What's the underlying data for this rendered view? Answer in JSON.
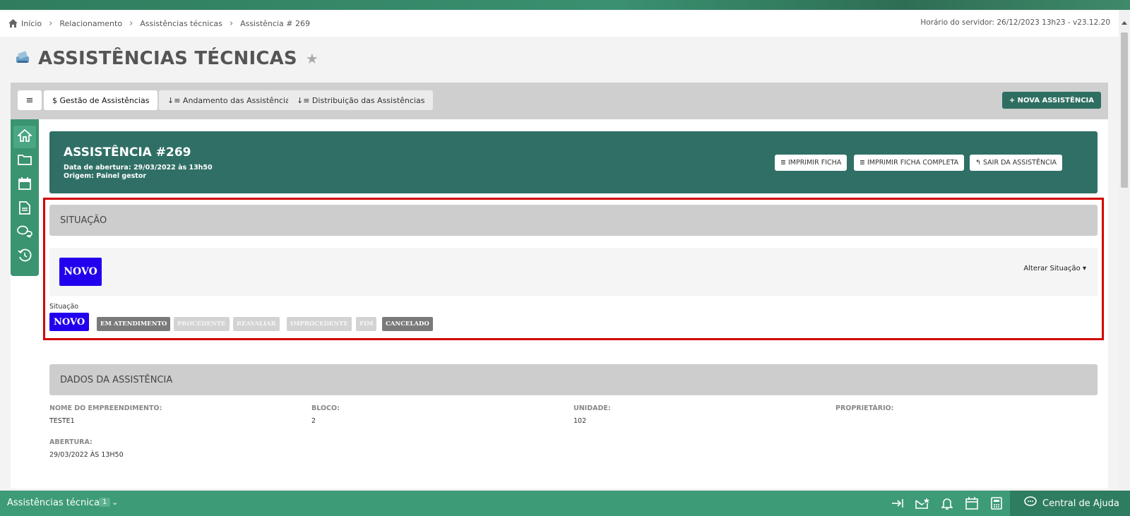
{
  "breadcrumb": {
    "items": [
      "Início",
      "Relacionamento",
      "Assistências técnicas",
      "Assistência # 269"
    ],
    "server_time": "Horário do servidor: 26/12/2023 13h23 - v23.12.20"
  },
  "page": {
    "title": "ASSISTÊNCIAS TÉCNICAS"
  },
  "tabs": [
    {
      "label": "$ Gestão de Assistências"
    },
    {
      "label": "↓≡ Andamento das Assistências"
    },
    {
      "label": "↓≡ Distribuição das Assistências"
    }
  ],
  "new_button": "+ NOVA ASSISTÊNCIA",
  "header": {
    "title": "ASSISTÊNCIA #269",
    "opened": "Data de abertura: 29/03/2022 às 13h50",
    "origin": "Origem: Painel gestor",
    "buttons": [
      "≣ IMPRIMIR FICHA",
      "≣ IMPRIMIR FICHA COMPLETA",
      "↰ SAIR DA ASSISTÊNCIA"
    ]
  },
  "situacao": {
    "heading": "SITUAÇÃO",
    "current": "NOVO",
    "change_label": "Alterar Situação ▾",
    "field_label": "Situação",
    "steps": [
      "NOVO",
      "EM ATENDIMENTO",
      "PROCEDENTE",
      "REAVALIAR",
      "IMPROCEDENTE",
      "FIM",
      "CANCELADO"
    ]
  },
  "dados": {
    "heading": "DADOS DA ASSISTÊNCIA",
    "fields": [
      {
        "label": "NOME DO EMPREENDIMENTO:",
        "value": "TESTE1"
      },
      {
        "label": "BLOCO:",
        "value": "2"
      },
      {
        "label": "UNIDADE:",
        "value": "102"
      },
      {
        "label": "PROPRIETÁRIO:",
        "value": ""
      },
      {
        "label": "ABERTURA:",
        "value": "29/03/2022 ÀS 13H50"
      }
    ]
  },
  "bottombar": {
    "label": "Assistências técnicas",
    "count": "1",
    "help": "Central de Ajuda"
  },
  "colors": {
    "brand_green": "#3e9b77",
    "header_dark": "#2f6f66",
    "status_new": "#2200ee",
    "highlight": "#d20000"
  }
}
